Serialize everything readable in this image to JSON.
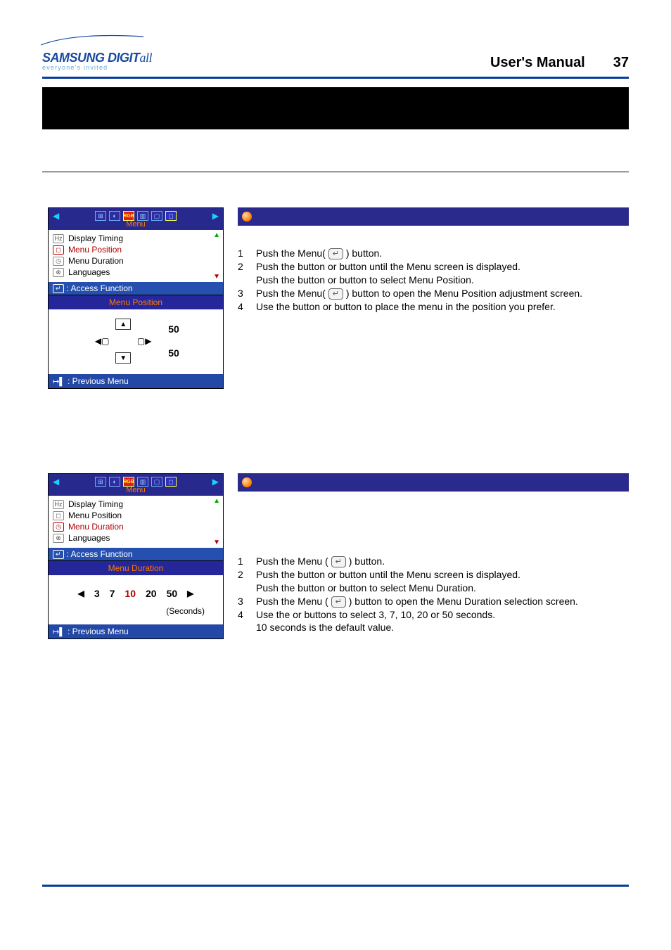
{
  "header": {
    "logo_main": "SAMSUNG DIGITall",
    "logo_sub": "everyone's invited",
    "manual_title": "User's Manual",
    "page_number": "37"
  },
  "osd": {
    "menu_label": "Menu",
    "items": [
      "Display Timing",
      "Menu Position",
      "Menu Duration",
      "Languages"
    ],
    "access_label": ": Access Function",
    "prev_label": ": Previous Menu",
    "pos_sub_title": "Menu Position",
    "pos_value_a": "50",
    "pos_value_b": "50",
    "dur_sub_title": "Menu Duration",
    "dur_options": [
      "3",
      "7",
      "10",
      "20",
      "50"
    ],
    "dur_selected": "10",
    "dur_seconds": "(Seconds)"
  },
  "section1": {
    "title": "",
    "steps": {
      "n1": "1",
      "t1a": "Push the Menu(",
      "t1b": ") button.",
      "n2": "2",
      "t2a": "Push the ",
      "t2b": " button or ",
      "t2c": " button until the Menu screen is displayed.",
      "t2d": "Push the ",
      "t2e": " button or ",
      "t2f": " button to select Menu Position.",
      "n3": "3",
      "t3a": "Push the Menu(",
      "t3b": ") button to open the Menu Position adjustment screen.",
      "n4": "4",
      "t4a": "Use the ",
      "t4b": " button or ",
      "t4c": " button to place the menu in the position you prefer."
    }
  },
  "section2": {
    "title": "",
    "steps": {
      "n1": "1",
      "t1a": "Push the Menu (",
      "t1b": ") button.",
      "n2": "2",
      "t2a": "Push the ",
      "t2b": " button or ",
      "t2c": " button until the Menu screen is displayed.",
      "t2d": "Push the ",
      "t2e": " button or ",
      "t2f": " button to select Menu Duration.",
      "n3": "3",
      "t3a": "Push the Menu (",
      "t3b": ") button to open the Menu Duration selection screen.",
      "n4": "4",
      "t4a": "Use the ",
      "t4b": " or ",
      "t4c": " buttons to select 3, 7, 10, 20 or 50 seconds.",
      "t4d": "10 seconds is the default value."
    }
  }
}
